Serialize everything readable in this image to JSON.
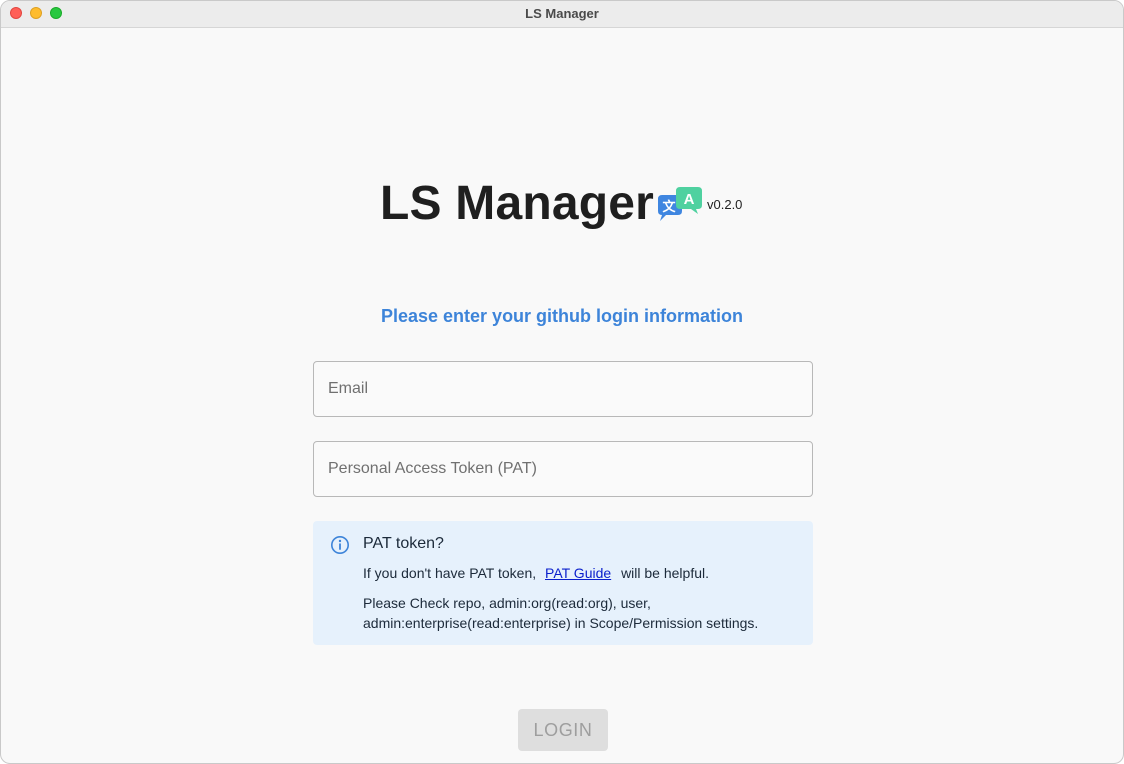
{
  "window": {
    "title": "LS Manager"
  },
  "brand": {
    "app_title": "LS Manager",
    "version": "v0.2.0",
    "icon": "translate-icon"
  },
  "login": {
    "subtitle": "Please enter your github login information",
    "email_placeholder": "Email",
    "pat_placeholder": "Personal Access Token (PAT)",
    "button_label": "LOGIN"
  },
  "info": {
    "icon": "info-icon",
    "title": "PAT token?",
    "line1_prefix": "If you don't have PAT token,",
    "guide_link": "PAT Guide",
    "line1_suffix": "will be helpful.",
    "line2": "Please Check repo, admin:org(read:org), user, admin:enterprise(read:enterprise) in Scope/Permission settings."
  },
  "colors": {
    "accent": "#3d84d9",
    "info_background": "#e6f1fc",
    "link": "#0a1fcc",
    "button_disabled": "#dedede"
  }
}
